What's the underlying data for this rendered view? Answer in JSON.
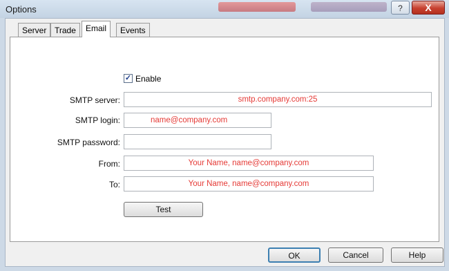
{
  "window": {
    "title": "Options"
  },
  "titlebar": {
    "help_glyph": "?",
    "close_glyph": "X"
  },
  "tabs": [
    {
      "label": "Server"
    },
    {
      "label": "Trade"
    },
    {
      "label": "Email",
      "active": true
    },
    {
      "label": "Events"
    }
  ],
  "email": {
    "enable_label": "Enable",
    "enable_checked": true,
    "smtp_server_label": "SMTP server:",
    "smtp_server_value": "smtp.company.com:25",
    "smtp_login_label": "SMTP login:",
    "smtp_login_value": "name@company.com",
    "smtp_password_label": "SMTP password:",
    "smtp_password_value": "",
    "from_label": "From:",
    "from_value": "Your Name, name@company.com",
    "to_label": "To:",
    "to_value": "Your Name, name@company.com",
    "test_button": "Test"
  },
  "footer": {
    "ok": "OK",
    "cancel": "Cancel",
    "help": "Help"
  },
  "colors": {
    "field_text": "#e53a36",
    "check_mark": "#1b3c8a"
  },
  "icons": {
    "check": "check-icon",
    "help": "question-icon",
    "close": "close-icon"
  }
}
